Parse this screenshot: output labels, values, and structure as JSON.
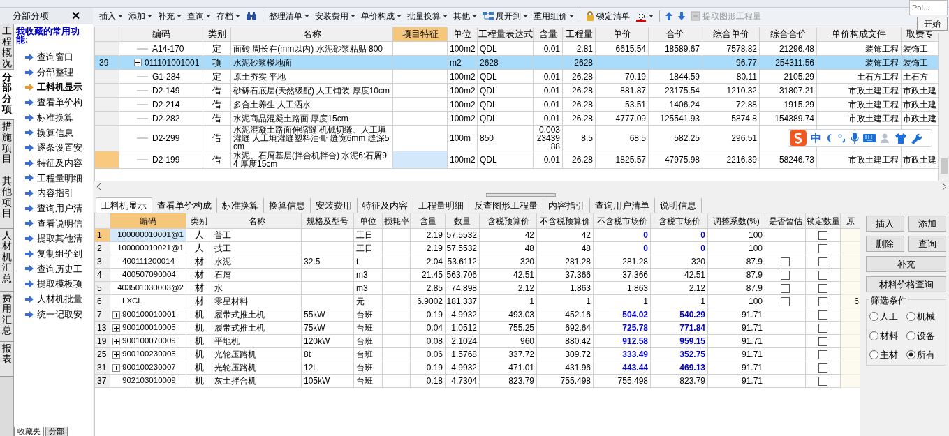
{
  "nav_tabs": [
    {
      "label": "工程概况",
      "selected": false
    },
    {
      "label": "分部分项",
      "selected": true
    },
    {
      "label": "措施项目",
      "selected": false
    },
    {
      "label": "其他项目",
      "selected": false
    },
    {
      "label": "人材机汇总",
      "selected": false
    },
    {
      "label": "费用汇总",
      "selected": false
    },
    {
      "label": "报表",
      "selected": false
    }
  ],
  "favorites_panel": {
    "header": "分部分项",
    "close": "✕",
    "title": "我收藏的常用功能:",
    "items": [
      {
        "label": "查询窗口",
        "selected": false
      },
      {
        "label": "分部整理",
        "selected": false
      },
      {
        "label": "工料机显示",
        "selected": true
      },
      {
        "label": "查看单价构",
        "selected": false
      },
      {
        "label": "标准换算",
        "selected": false
      },
      {
        "label": "换算信息",
        "selected": false
      },
      {
        "label": "逐条设置安",
        "selected": false
      },
      {
        "label": "特征及内容",
        "selected": false
      },
      {
        "label": "工程量明细",
        "selected": false
      },
      {
        "label": "内容指引",
        "selected": false
      },
      {
        "label": "查询用户清",
        "selected": false
      },
      {
        "label": "查看说明信",
        "selected": false
      },
      {
        "label": "提取其他清",
        "selected": false
      },
      {
        "label": "复制组价到",
        "selected": false
      },
      {
        "label": "查询历史工",
        "selected": false
      },
      {
        "label": "提取模板项",
        "selected": false
      },
      {
        "label": "人材机批量",
        "selected": false
      },
      {
        "label": "统一记取安",
        "selected": false
      }
    ],
    "bottom_tabs": [
      {
        "label": "收藏夹",
        "selected": true
      },
      {
        "label": "分部",
        "selected": false
      }
    ]
  },
  "toolbar": [
    {
      "kind": "menu",
      "label": "插入"
    },
    {
      "kind": "menu",
      "label": "添加"
    },
    {
      "kind": "menu",
      "label": "补充"
    },
    {
      "kind": "menu",
      "label": "查询"
    },
    {
      "kind": "menu",
      "label": "存档"
    },
    {
      "kind": "find"
    },
    {
      "kind": "separator"
    },
    {
      "kind": "menu",
      "label": "整理清单"
    },
    {
      "kind": "menu",
      "label": "安装费用"
    },
    {
      "kind": "menu",
      "label": "单价构成"
    },
    {
      "kind": "menu",
      "label": "批量换算"
    },
    {
      "kind": "menu",
      "label": "其他"
    },
    {
      "kind": "expand",
      "label": "展开到"
    },
    {
      "kind": "menu",
      "label": "重用组价"
    },
    {
      "kind": "separator"
    },
    {
      "kind": "lock",
      "label": "锁定清单"
    },
    {
      "kind": "paint"
    },
    {
      "kind": "separator"
    },
    {
      "kind": "up"
    },
    {
      "kind": "down"
    },
    {
      "kind": "extract",
      "label": "提取图形工程量",
      "disabled": true
    }
  ],
  "corner": {
    "field": "Poi...",
    "button": "开始"
  },
  "upper_table": {
    "columns": [
      {
        "label": "编码",
        "highlighted": false
      },
      {
        "label": "类别",
        "highlighted": false
      },
      {
        "label": "名称",
        "highlighted": false
      },
      {
        "label": "项目特征",
        "highlighted": true
      },
      {
        "label": "单位",
        "highlighted": false
      },
      {
        "label": "工程量表达式",
        "highlighted": false
      },
      {
        "label": "含量",
        "highlighted": false
      },
      {
        "label": "工程量",
        "highlighted": false
      },
      {
        "label": "单价",
        "highlighted": false
      },
      {
        "label": "合价",
        "highlighted": false
      },
      {
        "label": "综合单价",
        "highlighted": false
      },
      {
        "label": "综合合价",
        "highlighted": false
      },
      {
        "label": "单价构成文件",
        "highlighted": false
      },
      {
        "label": "取费专",
        "highlighted": false
      }
    ],
    "rows": [
      {
        "kind": "leaf",
        "selected": false,
        "current": false,
        "cells": [
          "A14-170",
          "定",
          "面砖 周长在(mm以内) 水泥砂浆粘贴 800",
          null,
          "100m2",
          "QDL",
          "0.01",
          "2.81",
          "6615.54",
          "18589.67",
          "7578.82",
          "21296.48",
          "装饰工程",
          "装饰工"
        ]
      },
      {
        "kind": "group",
        "number": "39",
        "selected": true,
        "current": false,
        "expanded": true,
        "cells": [
          "011101001001",
          "项",
          "水泥砂浆楼地面",
          null,
          "m2",
          "2628",
          null,
          "2628",
          null,
          null,
          "96.77",
          "254311.56",
          "装饰工程",
          "装饰工"
        ],
        "children": [
          {
            "kind": "leaf",
            "selected": false,
            "current": false,
            "cells": [
              "G1-284",
              "定",
              "原土夯实 平地",
              null,
              "100m2",
              "QDL",
              "0.01",
              "26.28",
              "70.19",
              "1844.59",
              "80.11",
              "2105.29",
              "土石方工程",
              "土石方"
            ]
          },
          {
            "kind": "leaf",
            "selected": false,
            "current": false,
            "cells": [
              "D2-149",
              "借",
              "砂砾石底层(天然级配) 人工铺装 厚度10cm",
              null,
              "100m2",
              "QDL",
              "0.01",
              "26.28",
              "881.87",
              "23175.54",
              "1210.32",
              "31807.21",
              "市政土建工程",
              "市政土建"
            ]
          },
          {
            "kind": "leaf",
            "selected": false,
            "current": false,
            "cells": [
              "D2-214",
              "借",
              "多合土养生 人工洒水",
              null,
              "100m2",
              "QDL",
              "0.01",
              "26.28",
              "53.51",
              "1406.24",
              "72.88",
              "1915.29",
              "市政土建工程",
              "市政土建"
            ]
          },
          {
            "kind": "leaf",
            "selected": false,
            "current": false,
            "cells": [
              "D2-282",
              "借",
              "水泥商品混凝土路面 厚度15cm",
              null,
              "100m2",
              "QDL",
              "0.01",
              "26.28",
              "4777.09",
              "125541.93",
              "5874.8",
              "154389.74",
              "市政土建工程",
              "市政土建"
            ]
          },
          {
            "kind": "leaf",
            "selected": false,
            "current": false,
            "cells": [
              "D2-299",
              "借",
              "水泥混凝土路面伸缩缝 机械切缝、人工填灌缝 人工填灌缝塑料油膏 缝宽6mm 缝深5cm",
              null,
              "100m",
              "850",
              "0.0032343988",
              "8.5",
              "68.5",
              "582.25",
              "296.51",
              null,
              null,
              null
            ]
          },
          {
            "kind": "leaf",
            "selected": false,
            "current": true,
            "cells": [
              "D2-199",
              "借",
              "水泥、石屑基层(拌合机拌合) 水泥6:石屑94 厚度15cm",
              null,
              "100m2",
              "QDL",
              "0.01",
              "26.28",
              "1825.57",
              "47975.98",
              "2216.39",
              "58246.73",
              "市政土建工程",
              "市政土建"
            ]
          }
        ]
      }
    ]
  },
  "ime_bar": {
    "label": "中"
  },
  "detail_tabs": [
    {
      "label": "工料机显示",
      "selected": true
    },
    {
      "label": "查看单价构成",
      "selected": false
    },
    {
      "label": "标准换算",
      "selected": false
    },
    {
      "label": "换算信息",
      "selected": false
    },
    {
      "label": "安装费用",
      "selected": false
    },
    {
      "label": "特征及内容",
      "selected": false
    },
    {
      "label": "工程量明细",
      "selected": false
    },
    {
      "label": "反查图形工程量",
      "selected": false
    },
    {
      "label": "内容指引",
      "selected": false
    },
    {
      "label": "查询用户清单",
      "selected": false
    },
    {
      "label": "说明信息",
      "selected": false
    }
  ],
  "resource_table": {
    "columns": [
      {
        "label": "编码",
        "highlighted": true
      },
      {
        "label": "类别",
        "highlighted": false
      },
      {
        "label": "名称",
        "highlighted": false
      },
      {
        "label": "规格及型号",
        "highlighted": false
      },
      {
        "label": "单位",
        "highlighted": false
      },
      {
        "label": "损耗率",
        "highlighted": false
      },
      {
        "label": "含量",
        "highlighted": false
      },
      {
        "label": "数量",
        "highlighted": false
      },
      {
        "label": "含税预算价",
        "highlighted": false
      },
      {
        "label": "不含税预算价",
        "highlighted": false
      },
      {
        "label": "不含税市场价",
        "highlighted": false
      },
      {
        "label": "含税市场价",
        "highlighted": false
      },
      {
        "label": "调整系数(%)",
        "highlighted": false
      },
      {
        "label": "是否暂估",
        "highlighted": false
      },
      {
        "label": "锁定数量",
        "highlighted": false
      },
      {
        "label": "原",
        "highlighted": false
      }
    ],
    "rows": [
      {
        "number": "1",
        "current": true,
        "price_changed": true,
        "locked": false,
        "cells": [
          "100000010001@1",
          "人",
          "普工",
          null,
          "工日",
          null,
          "2.19",
          "57.5532",
          "42",
          "42",
          "0",
          "0",
          "100"
        ]
      },
      {
        "number": "2",
        "current": false,
        "price_changed": true,
        "locked": false,
        "cells": [
          "100000010021@1",
          "人",
          "技工",
          null,
          "工日",
          null,
          "2.19",
          "57.5532",
          "48",
          "48",
          "0",
          "0",
          "100"
        ]
      },
      {
        "number": "3",
        "current": false,
        "price_changed": false,
        "locked": false,
        "estimated": false,
        "cells": [
          "400111200014",
          "材",
          "水泥",
          "32.5",
          "t",
          null,
          "2.04",
          "53.6112",
          "320",
          "281.28",
          "281.28",
          "320",
          "87.9"
        ]
      },
      {
        "number": "4",
        "current": false,
        "price_changed": false,
        "locked": false,
        "estimated": false,
        "cells": [
          "400507090004",
          "材",
          "石屑",
          null,
          "m3",
          null,
          "21.45",
          "563.706",
          "42.51",
          "37.366",
          "37.366",
          "42.51",
          "87.9"
        ]
      },
      {
        "number": "5",
        "current": false,
        "price_changed": false,
        "locked": false,
        "estimated": false,
        "cells": [
          "403501030003@2",
          "材",
          "水",
          null,
          "m3",
          null,
          "2.85",
          "74.898",
          "2.12",
          "1.863",
          "1.863",
          "2.12",
          "87.9"
        ]
      },
      {
        "number": "6",
        "current": false,
        "price_changed": false,
        "locked": false,
        "estimated": false,
        "original": "6",
        "cells": [
          "LXCL",
          "材",
          "零星材料",
          null,
          "元",
          null,
          "6.9002",
          "181.337",
          "1",
          "1",
          "1",
          "1",
          "100"
        ]
      },
      {
        "number": "7",
        "current": false,
        "price_changed": true,
        "locked": false,
        "expanded": false,
        "cells": [
          "900100010001",
          "机",
          "履带式推土机",
          "55kW",
          "台班",
          null,
          "0.19",
          "4.9932",
          "493.03",
          "452.16",
          "504.02",
          "540.29",
          "91.71"
        ]
      },
      {
        "number": "13",
        "current": false,
        "price_changed": true,
        "locked": false,
        "expanded": false,
        "cells": [
          "900100010005",
          "机",
          "履带式推土机",
          "75kW",
          "台班",
          null,
          "0.04",
          "1.0512",
          "755.25",
          "692.64",
          "725.78",
          "771.84",
          "91.71"
        ]
      },
      {
        "number": "19",
        "current": false,
        "price_changed": true,
        "locked": false,
        "expanded": false,
        "cells": [
          "900100070009",
          "机",
          "平地机",
          "120kW",
          "台班",
          null,
          "0.08",
          "2.1024",
          "960",
          "880.42",
          "912.58",
          "959.15",
          "91.71"
        ]
      },
      {
        "number": "25",
        "current": false,
        "price_changed": true,
        "locked": false,
        "expanded": false,
        "cells": [
          "900100230005",
          "机",
          "光轮压路机",
          "8t",
          "台班",
          null,
          "0.06",
          "1.5768",
          "337.72",
          "309.72",
          "333.49",
          "352.75",
          "91.71"
        ]
      },
      {
        "number": "31",
        "current": false,
        "price_changed": true,
        "locked": false,
        "expanded": false,
        "cells": [
          "900100230007",
          "机",
          "光轮压路机",
          "12t",
          "台班",
          null,
          "0.19",
          "4.9932",
          "471.01",
          "431.96",
          "443.44",
          "469.13",
          "91.71"
        ]
      },
      {
        "number": "37",
        "current": false,
        "price_changed": false,
        "locked": false,
        "cells": [
          "902103010009",
          "机",
          "灰土拌合机",
          "105kW",
          "台班",
          null,
          "0.18",
          "4.7304",
          "823.79",
          "755.498",
          "755.498",
          "823.79",
          "91.71"
        ]
      }
    ]
  },
  "side_buttons": [
    [
      "插入",
      "添加"
    ],
    [
      "删除",
      "查询"
    ],
    [
      "补充"
    ],
    [
      "材料价格查询"
    ]
  ],
  "filter": {
    "title": "筛选条件",
    "options": [
      {
        "label": "人工",
        "selected": false
      },
      {
        "label": "机械",
        "selected": false
      },
      {
        "label": "材料",
        "selected": false
      },
      {
        "label": "设备",
        "selected": false
      },
      {
        "label": "主材",
        "selected": false
      },
      {
        "label": "所有",
        "selected": true
      }
    ]
  }
}
